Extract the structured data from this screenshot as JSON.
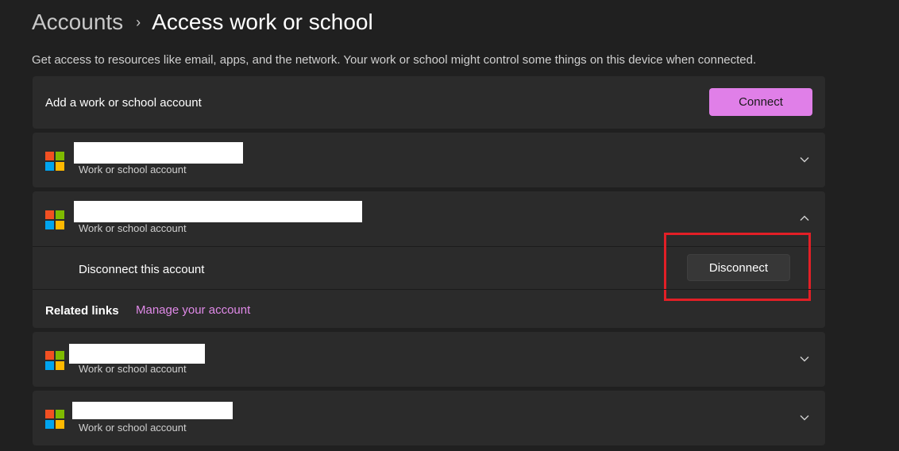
{
  "breadcrumb": {
    "parent": "Accounts",
    "separator": "›",
    "current": "Access work or school"
  },
  "description": "Get access to resources like email, apps, and the network. Your work or school might control some things on this device when connected.",
  "add_account": {
    "label": "Add a work or school account",
    "button_label": "Connect"
  },
  "accounts": [
    {
      "type_label": "Work or school account",
      "expanded": false
    },
    {
      "type_label": "Work or school account",
      "expanded": true
    },
    {
      "type_label": "Work or school account",
      "expanded": false
    },
    {
      "type_label": "Work or school account",
      "expanded": false
    }
  ],
  "expanded_account": {
    "disconnect_label": "Disconnect this account",
    "disconnect_button": "Disconnect",
    "related_links_label": "Related links",
    "manage_link": "Manage your account"
  },
  "colors": {
    "accent": "#e07fe8",
    "highlight": "#e21f26",
    "background": "#202020",
    "card": "#2b2b2b"
  }
}
